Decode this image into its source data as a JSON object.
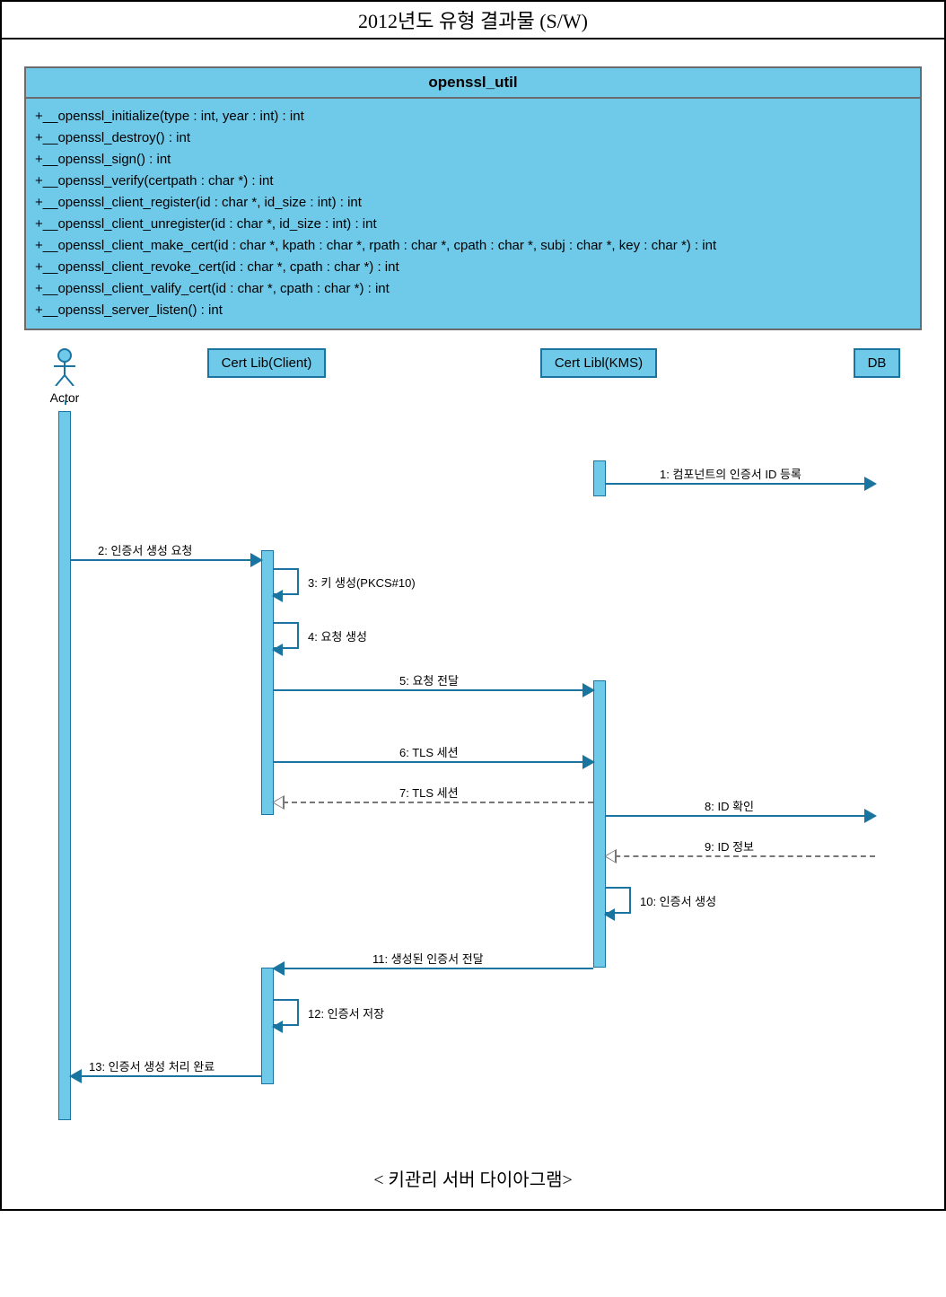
{
  "title": "2012년도 유형 결과물 (S/W)",
  "class": {
    "name": "openssl_util",
    "methods": [
      "+__openssl_initialize(type : int, year : int) : int",
      "+__openssl_destroy() : int",
      "+__openssl_sign() : int",
      "+__openssl_verify(certpath : char *) : int",
      "+__openssl_client_register(id : char *, id_size : int) : int",
      "+__openssl_client_unregister(id : char *, id_size : int) : int",
      "+__openssl_client_make_cert(id : char *, kpath : char *, rpath : char *, cpath : char *, subj : char *, key : char *) : int",
      "+__openssl_client_revoke_cert(id : char *, cpath : char *) : int",
      "+__openssl_client_valify_cert(id : char *, cpath : char *) : int",
      "+__openssl_server_listen() : int"
    ]
  },
  "lifelines": {
    "actor": "Actor",
    "client": "Cert Lib(Client)",
    "kms": "Cert Libl(KMS)",
    "db": "DB"
  },
  "messages": {
    "m1": "1: 컴포넌트의 인증서 ID 등록",
    "m2": "2: 인증서 생성 요청",
    "m3": "3: 키 생성(PKCS#10)",
    "m4": "4: 요청 생성",
    "m5": "5: 요청 전달",
    "m6": "6: TLS 세션",
    "m7": "7: TLS 세션",
    "m8": "8: ID 확인",
    "m9": "9: ID 정보",
    "m10": "10: 인증서 생성",
    "m11": "11: 생성된 인증서 전달",
    "m12": "12: 인증서 저장",
    "m13": "13: 인증서 생성 처리 완료"
  },
  "caption": "< 키관리 서버 다이아그램>"
}
